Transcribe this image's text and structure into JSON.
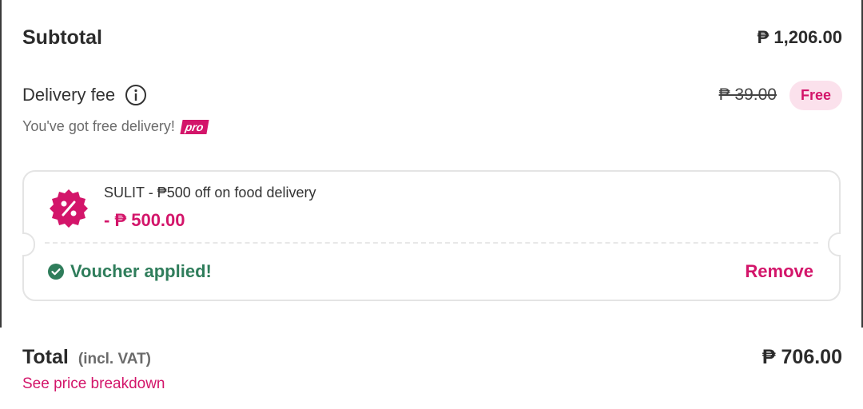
{
  "subtotal": {
    "label": "Subtotal",
    "amount": "₱ 1,206.00"
  },
  "delivery": {
    "label": "Delivery fee",
    "info_icon": "info-icon",
    "original_fee": "₱ 39.00",
    "badge": "Free",
    "free_message": "You've got free delivery!",
    "pro_badge": "pro"
  },
  "voucher": {
    "icon": "discount-icon",
    "title": "SULIT - ₱500 off on food delivery",
    "amount": "- ₱ 500.00",
    "status_icon": "check-circle-icon",
    "status": "Voucher applied!",
    "remove_label": "Remove"
  },
  "total": {
    "label": "Total",
    "vat_note": "(incl. VAT)",
    "amount": "₱ 706.00",
    "breakdown_link": "See price breakdown"
  },
  "colors": {
    "accent": "#d3156a",
    "badge_bg": "#fbe1ec",
    "success": "#2f7d5b",
    "text": "#2b2b2b",
    "muted": "#6b6b6b"
  }
}
